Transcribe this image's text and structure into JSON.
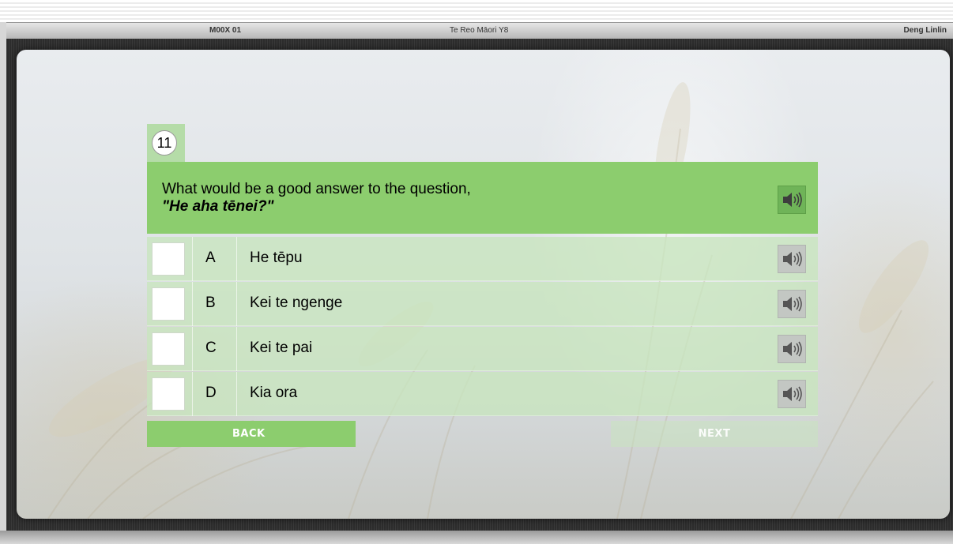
{
  "header": {
    "module_code": "M00X 01",
    "course_title": "Te Reo Māori Y8",
    "user_name": "Deng Linlin"
  },
  "question": {
    "number": "11",
    "text_line1": "What would be a good answer to the question,",
    "text_line2": "\"He aha tēnei?\"",
    "audio_icon": "speaker-icon"
  },
  "options": [
    {
      "letter": "A",
      "text": "He tēpu",
      "checked": false
    },
    {
      "letter": "B",
      "text": "Kei te ngenge",
      "checked": false
    },
    {
      "letter": "C",
      "text": "Kei te pai",
      "checked": false
    },
    {
      "letter": "D",
      "text": "Kia ora",
      "checked": false
    }
  ],
  "navigation": {
    "back_label": "BACK",
    "next_label": "NEXT"
  },
  "colors": {
    "accent_green": "#8ccd6e",
    "option_green": "#c8e6be",
    "audio_active": "#6fb458"
  }
}
